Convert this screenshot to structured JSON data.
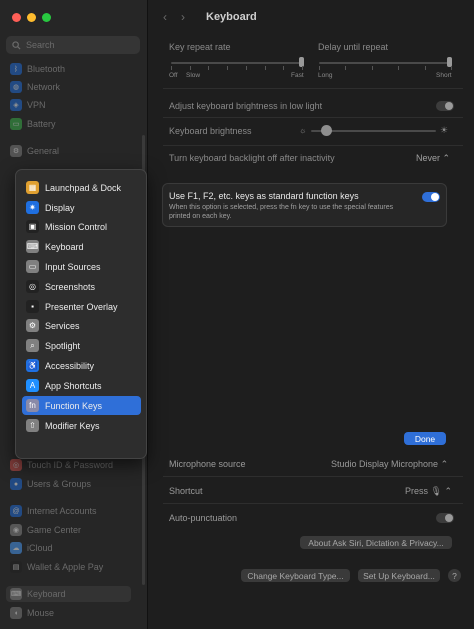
{
  "window": {
    "title": "Keyboard"
  },
  "sidebar": {
    "search_placeholder": "Search",
    "items": [
      {
        "label": "Bluetooth",
        "icon": "bluetooth-icon",
        "color": "#1f6fe0"
      },
      {
        "label": "Network",
        "icon": "globe-icon",
        "color": "#1f6fe0"
      },
      {
        "label": "VPN",
        "icon": "vpn-icon",
        "color": "#1f6fe0"
      },
      {
        "label": "Battery",
        "icon": "battery-icon",
        "color": "#3ab54a"
      },
      {
        "label": "General",
        "icon": "gear-icon",
        "color": "#808080"
      },
      {
        "label": "Touch ID & Password",
        "icon": "fingerprint-icon",
        "color": "#d9534f"
      },
      {
        "label": "Users & Groups",
        "icon": "users-icon",
        "color": "#1f6fe0"
      },
      {
        "label": "Internet Accounts",
        "icon": "at-icon",
        "color": "#1f6fe0"
      },
      {
        "label": "Game Center",
        "icon": "game-center-icon",
        "color": "#888888"
      },
      {
        "label": "iCloud",
        "icon": "cloud-icon",
        "color": "#4aa0ff"
      },
      {
        "label": "Wallet & Apple Pay",
        "icon": "wallet-icon",
        "color": "#222222"
      },
      {
        "label": "Keyboard",
        "icon": "keyboard-icon",
        "color": "#808080"
      },
      {
        "label": "Mouse",
        "icon": "mouse-icon",
        "color": "#808080"
      }
    ]
  },
  "keyboard": {
    "key_repeat_label": "Key repeat rate",
    "delay_label": "Delay until repeat",
    "repeat_ticks": [
      "Off",
      "Slow",
      "Fast"
    ],
    "delay_ticks": [
      "Long",
      "Short"
    ],
    "adjust_brightness_label": "Adjust keyboard brightness in low light",
    "brightness_label": "Keyboard brightness",
    "brightness_level": 0.12,
    "backlight_off_label": "Turn keyboard backlight off after inactivity",
    "backlight_off_value": "Never"
  },
  "function_keys": {
    "title": "Use F1, F2, etc. keys as standard function keys",
    "description": "When this option is selected, press the fn key to use the special features printed on each key.",
    "enabled": true,
    "done_label": "Done"
  },
  "dictation": {
    "mic_label": "Microphone source",
    "mic_value": "Studio Display Microphone",
    "shortcut_label": "Shortcut",
    "shortcut_value": "Press",
    "autopunct_label": "Auto-punctuation",
    "about_button": "About Ask Siri, Dictation & Privacy...",
    "change_type_button": "Change Keyboard Type...",
    "setup_button": "Set Up Keyboard...",
    "help_label": "?"
  },
  "menu": {
    "items": [
      {
        "label": "Launchpad & Dock",
        "icon": "launchpad-icon",
        "color": "#e0a030"
      },
      {
        "label": "Display",
        "icon": "display-icon",
        "color": "#1f6fe0"
      },
      {
        "label": "Mission Control",
        "icon": "mission-control-icon",
        "color": "#222222"
      },
      {
        "label": "Keyboard",
        "icon": "keyboard-icon",
        "color": "#808080"
      },
      {
        "label": "Input Sources",
        "icon": "input-sources-icon",
        "color": "#808080"
      },
      {
        "label": "Screenshots",
        "icon": "screenshot-icon",
        "color": "#222222"
      },
      {
        "label": "Presenter Overlay",
        "icon": "presenter-overlay-icon",
        "color": "#222222"
      },
      {
        "label": "Services",
        "icon": "services-icon",
        "color": "#808080"
      },
      {
        "label": "Spotlight",
        "icon": "spotlight-icon",
        "color": "#808080"
      },
      {
        "label": "Accessibility",
        "icon": "accessibility-icon",
        "color": "#1f6fe0"
      },
      {
        "label": "App Shortcuts",
        "icon": "app-store-icon",
        "color": "#1f8fff"
      },
      {
        "label": "Function Keys",
        "icon": "function-keys-icon",
        "color": "#8a8aa8"
      },
      {
        "label": "Modifier Keys",
        "icon": "modifier-keys-icon",
        "color": "#808080"
      }
    ],
    "selected_index": 11
  },
  "colors": {
    "accent": "#2f6fd8",
    "close": "#ff5f57",
    "minimize": "#febc2e",
    "zoom": "#28c840"
  }
}
